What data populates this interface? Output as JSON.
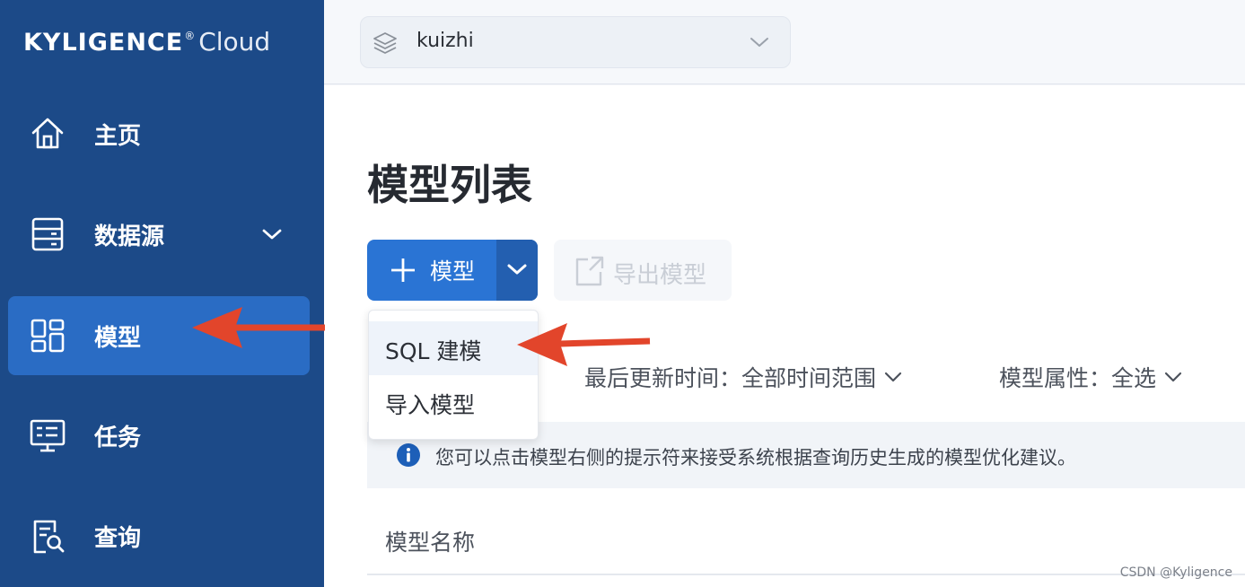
{
  "sidebar": {
    "logo_brand": "KYLIGENCE",
    "logo_mark": "®",
    "logo_product": "Cloud",
    "items": [
      {
        "label": "主页",
        "icon": "home-icon"
      },
      {
        "label": "数据源",
        "icon": "database-icon",
        "expandable": true
      },
      {
        "label": "模型",
        "icon": "model-grid-icon",
        "active": true
      },
      {
        "label": "任务",
        "icon": "monitor-icon"
      },
      {
        "label": "查询",
        "icon": "query-search-icon"
      }
    ]
  },
  "topbar": {
    "project_value": "kuizhi",
    "project_icon": "layers-icon"
  },
  "main": {
    "title": "模型列表",
    "add_model_label": "模型",
    "export_label": "导出模型",
    "filter_time": "最后更新时间：全部时间范围",
    "filter_attr": "模型属性：全选",
    "info_text": "您可以点击模型右侧的提示符来接受系统根据查询历史生成的模型优化建议。",
    "column_model_name": "模型名称"
  },
  "dropdown": {
    "items": [
      "SQL 建模",
      "导入模型"
    ],
    "hovered_index": 0
  },
  "annotations": {
    "arrow_color": "#e2452b"
  },
  "watermark": "CSDN @Kyligence",
  "colors": {
    "sidebar_bg": "#1c4a88",
    "sidebar_active": "#2a6cc4",
    "primary_button": "#2a74d4",
    "primary_button_split": "#235fb0",
    "info_icon": "#1d5fb8"
  }
}
